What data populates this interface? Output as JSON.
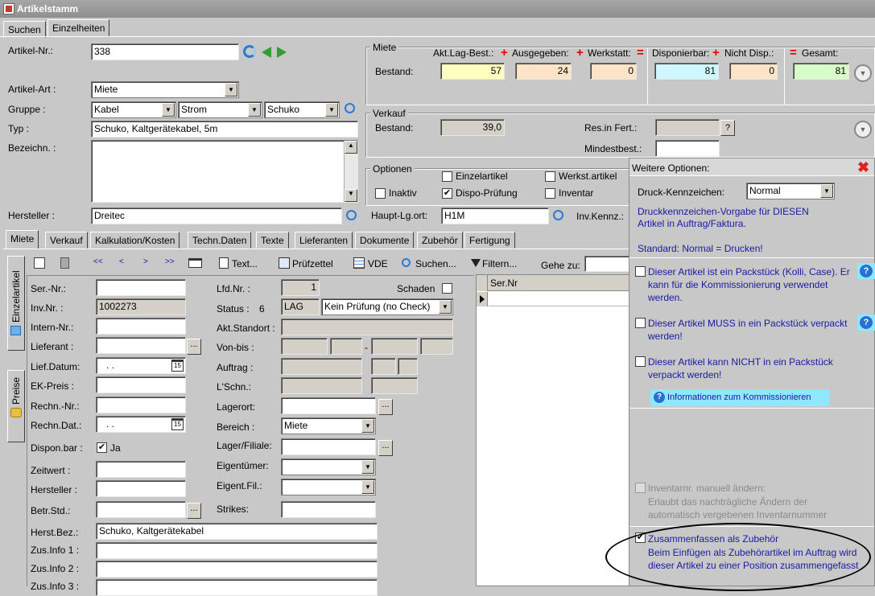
{
  "window": {
    "title": "Artikelstamm"
  },
  "top_tabs": [
    "Suchen",
    "Einzelheiten"
  ],
  "left": {
    "artikel_nr_label": "Artikel-Nr.:",
    "artikel_nr": "338",
    "artikel_art_label": "Artikel-Art :",
    "artikel_art": "Miete",
    "gruppe_label": "Gruppe :",
    "gruppe1": "Kabel",
    "gruppe2": "Strom",
    "gruppe3": "Schuko",
    "typ_label": "Typ :",
    "typ": "Schuko, Kaltgerätekabel, 5m",
    "bezeichn_label": "Bezeichn. :",
    "hersteller_label": "Hersteller :",
    "hersteller": "Dreitec"
  },
  "miete": {
    "title": "Miete",
    "bestand_label": "Bestand:",
    "akt_lag_label": "Akt.Lag-Best.:",
    "akt_lag": "57",
    "ausgegeben_label": "Ausgegeben:",
    "ausgegeben": "24",
    "werkstatt_label": "Werkstatt:",
    "werkstatt": "0",
    "disponierbar_label": "Disponierbar:",
    "disponierbar": "81",
    "nicht_disp_label": "Nicht Disp.:",
    "nicht_disp": "0",
    "gesamt_label": "Gesamt:",
    "gesamt": "81",
    "plus": "+",
    "eq": "="
  },
  "verkauf": {
    "title": "Verkauf",
    "bestand_label": "Bestand:",
    "bestand": "39,0",
    "res_label": "Res.in Fert.:",
    "res_btn": "?",
    "mindest_label": "Mindestbest.:"
  },
  "optionen": {
    "title": "Optionen",
    "einzelartikel": "Einzelartikel",
    "werkst": "Werkst.artikel",
    "inaktiv": "Inaktiv",
    "dispo": "Dispo-Prüfung",
    "inventar": "Inventar"
  },
  "hauptlg": {
    "label": "Haupt-Lg.ort:",
    "value": "H1M",
    "inv_label": "Inv.Kennz.:"
  },
  "subtabs": [
    "Miete",
    "Verkauf",
    "Kalkulation/Kosten",
    "Techn.Daten",
    "Texte",
    "Lieferanten",
    "Dokumente",
    "Zubehör",
    "Fertigung"
  ],
  "sidetabs": {
    "einzel": "Einzelartikel",
    "preise": "Preise"
  },
  "toolbar": {
    "first": "<<",
    "prev": "<",
    "next": ">",
    "last": ">>",
    "text": "Text...",
    "pruef": "Prüfzettel",
    "vde": "VDE",
    "suchen": "Suchen...",
    "filtern": "Filtern...",
    "gehe": "Gehe zu:"
  },
  "form": {
    "ser_nr": "Ser.-Nr.:",
    "inv_nr": "Inv.Nr. :",
    "inv_nr_val": "1002273",
    "intern": "Intern-Nr.:",
    "lieferant": "Lieferant :",
    "lief_datum": "Lief.Datum:",
    "date_ph": ". .",
    "ek_preis": "EK-Preis :",
    "rechn_nr": "Rechn.-Nr.:",
    "rechn_dat": "Rechn.Dat.:",
    "dispon": "Dispon.bar :",
    "dispon_val": "Ja",
    "zeitwert": "Zeitwert :",
    "hersteller": "Hersteller :",
    "betr_std": "Betr.Std.:",
    "herst_bez": "Herst.Bez.:",
    "herst_bez_val": "Schuko, Kaltgerätekabel",
    "zus1": "Zus.Info 1 :",
    "zus2": "Zus.Info 2 :",
    "zus3": "Zus.Info 3 :",
    "lfd_nr": "Lfd.Nr. :",
    "lfd_nr_val": "1",
    "schaden": "Schaden",
    "status": "Status :",
    "status_num": "6",
    "status_code": "LAG",
    "status_sel": "Kein Prüfung (no Check)",
    "akt_standort": "Akt.Standort :",
    "von_bis": "Von-bis :",
    "dash": "-",
    "auftrag": "Auftrag :",
    "lschn": "L'Schn.:",
    "lagerort": "Lagerort:",
    "bereich": "Bereich :",
    "bereich_val": "Miete",
    "lager_filiale": "Lager/Filiale:",
    "eigentuemer": "Eigentümer:",
    "eigent_fil": "Eigent.Fil.:",
    "strikes": "Strikes:",
    "ellipsis": "..."
  },
  "grid": {
    "col": "Ser.Nr"
  },
  "panel": {
    "title": "Weitere Optionen:",
    "druck_label": "Druck-Kennzeichen:",
    "druck_val": "Normal",
    "druck_desc": "Druckkennzeichen-Vorgabe für DIESEN Artikel  in Auftrag/Faktura.",
    "druck_std": "Standard: Normal = Drucken!",
    "opt1": "Dieser Artikel ist ein Packstück (Kolli, Case). Er kann für die Kommissionierung verwendet werden.",
    "opt2": "Dieser Artikel MUSS in ein Packstück verpackt werden!",
    "opt3": "Dieser Artikel kann NICHT in ein Packstück verpackt werden!",
    "info_btn": "Informationen zum Kommissionieren",
    "inv_title": "Inventarnr. manuell ändern:",
    "inv_desc": "Erlaubt das nachträgliche Ändern der automatisch vergebenen Inventarnummer",
    "zus_title": "Zusammenfassen als Zubehör",
    "zus_desc": "Beim Einfügen als Zubehörartikel im Auftrag wird dieser Artikel zu einer Position zusammengefasst"
  }
}
